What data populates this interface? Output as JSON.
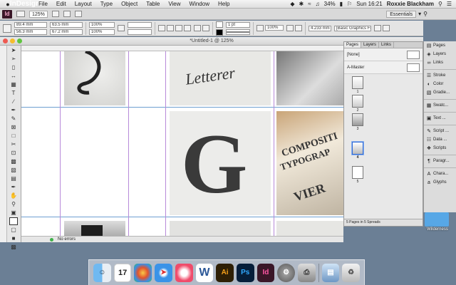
{
  "menubar": {
    "apple": "",
    "items": [
      "InDesign",
      "File",
      "Edit",
      "Layout",
      "Type",
      "Object",
      "Table",
      "View",
      "Window",
      "Help"
    ],
    "battery": "34%",
    "clock": "Sun 16:21",
    "user": "Roxxie Blackham"
  },
  "appbar": {
    "logo": "Id",
    "zoom": "125%",
    "workspace": "Essentials"
  },
  "control": {
    "x": "89.4 mm",
    "y": "56.3 mm",
    "w": "63.5 mm",
    "h": "67.2 mm",
    "stroke_weight": "1 pt",
    "pct1": "100%",
    "pct2": "100%",
    "offset": "4.233 mm",
    "style": "[Basic Graphics Frame]"
  },
  "document": {
    "title": "*Untitled-1 @ 125%"
  },
  "status": {
    "errors": "No errors"
  },
  "pages_panel": {
    "tabs": [
      "Pages",
      "Layers",
      "Links"
    ],
    "none": "[None]",
    "master": "A-Master",
    "page_numbers": [
      "1",
      "2",
      "3",
      "4",
      "5"
    ],
    "footer": "5 Pages in 5 Spreads"
  },
  "dock": {
    "group1": [
      {
        "icon": "pages-icon",
        "label": "Pages"
      },
      {
        "icon": "layers-icon",
        "label": "Layers"
      },
      {
        "icon": "links-icon",
        "label": "Links"
      }
    ],
    "group2": [
      {
        "icon": "stroke-icon",
        "label": "Stroke"
      },
      {
        "icon": "color-icon",
        "label": "Color"
      },
      {
        "icon": "gradient-icon",
        "label": "Gradie..."
      }
    ],
    "group3": [
      {
        "icon": "swatches-icon",
        "label": "Swatc..."
      }
    ],
    "group4": [
      {
        "icon": "text-wrap-icon",
        "label": "Text ..."
      }
    ],
    "group5": [
      {
        "icon": "script-label-icon",
        "label": "Script ..."
      },
      {
        "icon": "data-merge-icon",
        "label": "Data ..."
      },
      {
        "icon": "scripts-icon",
        "label": "Scripts"
      }
    ],
    "group6": [
      {
        "icon": "paragraph-icon",
        "label": "Paragr..."
      }
    ],
    "group7": [
      {
        "icon": "character-icon",
        "label": "Chara..."
      },
      {
        "icon": "glyphs-icon",
        "label": "Glyphs"
      }
    ]
  },
  "desktop": {
    "folder_label": "Wilderness"
  },
  "osdock": {
    "calendar_day": "17",
    "apps": [
      "Finder",
      "Calendar",
      "Photos",
      "Safari",
      "iTunes",
      "Word",
      "Illustrator",
      "Photoshop",
      "InDesign",
      "System Preferences",
      "Printer",
      "Preview",
      "Trash"
    ],
    "ai": "Ai",
    "ps": "Ps",
    "id": "Id",
    "w": "W"
  },
  "artwork": {
    "big_letter": "G",
    "letterer": "Letterer",
    "compo": "COMPOSITI",
    "typo": "TYPOGRAP",
    "vier": "VIER"
  }
}
